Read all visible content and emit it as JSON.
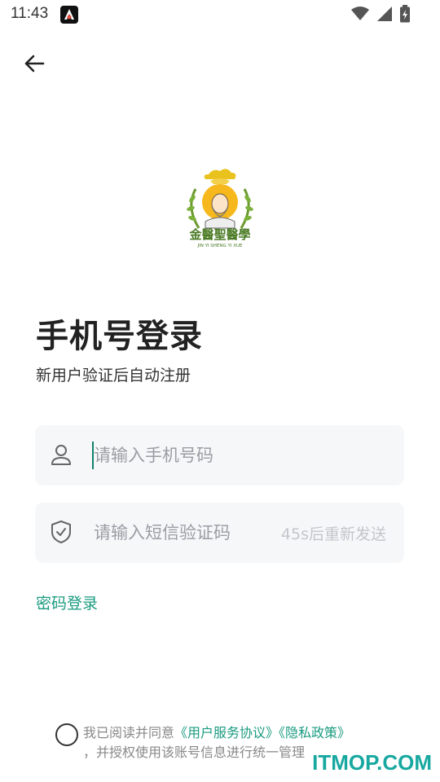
{
  "status_bar": {
    "time": "11:43"
  },
  "login": {
    "title": "手机号登录",
    "subtitle": "新用户验证后自动注册",
    "phone_placeholder": "请输入手机号码",
    "code_placeholder": "请输入短信验证码",
    "resend_label": "45s后重新发送",
    "password_login": "密码登录"
  },
  "agreement": {
    "prefix": "我已阅读并同意",
    "user_agreement": "《用户服务协议》",
    "privacy_policy": "《隐私政策》",
    "suffix": "，并授权使用该账号信息进行统一管理"
  },
  "logo": {
    "name": "金醫聖醫學",
    "roman": "JIN YI SHENG YI XUE"
  },
  "watermark": "ITMOP.COM",
  "colors": {
    "accent": "#1a9b80",
    "field_bg": "#f5f7f9",
    "placeholder": "#9a9ea3"
  }
}
